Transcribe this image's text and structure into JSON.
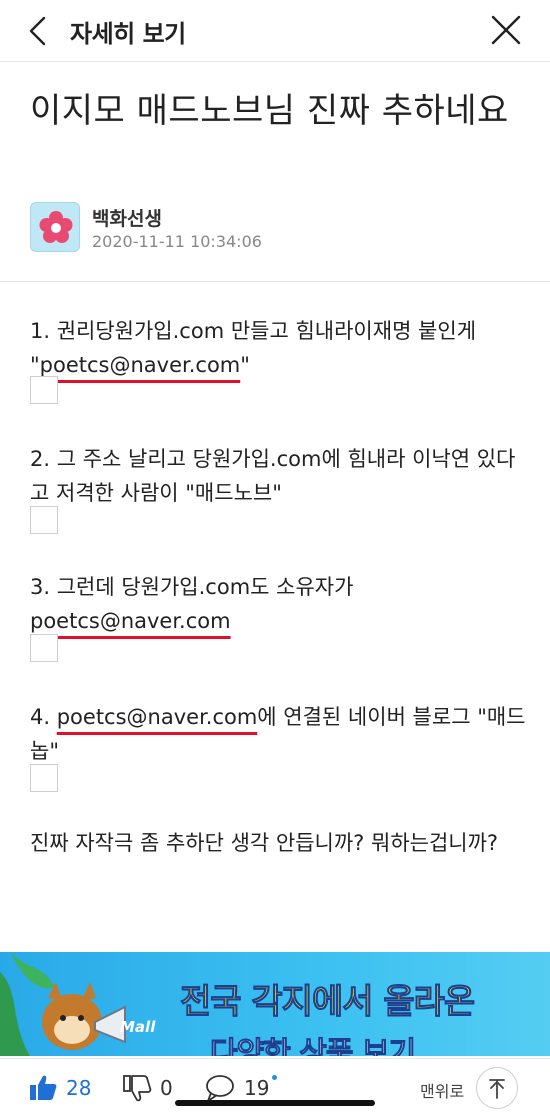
{
  "header": {
    "title": "자세히 보기"
  },
  "post": {
    "title": "이지모 매드노브님 진짜 추하네요",
    "author": "백화선생",
    "date": "2020-11-11 10:34:06"
  },
  "content": {
    "p1_before": "1. 권리당원가입.com 만들고 힘내라이재명 붙인게 \"",
    "p1_email": "poetcs@naver.com",
    "p1_after": "\"",
    "p2": "2. 그 주소 날리고 당원가입.com에 힘내라 이낙연 있다고 저격한 사람이 \"매드노브\"",
    "p3_before": "3. 그런데 당원가입.com도 소유자가 ",
    "p3_email": "poetcs@naver.com",
    "p4_before": "4. ",
    "p4_email": "poetcs@naver.com",
    "p4_after": "에 연결된 네이버 블로그 \"매드놉\"",
    "p5": "진짜 자작극 좀 추하단 생각 안듭니까? 뭐하는겁니까?"
  },
  "banner": {
    "line1": "전국 각지에서 올라온",
    "line2": "다양한 상품 보기",
    "mall": "Mall"
  },
  "bottom": {
    "likes": "28",
    "dislikes": "0",
    "comments": "19",
    "top_label": "맨위로"
  },
  "colors": {
    "like": "#1f6fd6",
    "underline": "#e0102b",
    "banner": "#2aa9e8"
  }
}
